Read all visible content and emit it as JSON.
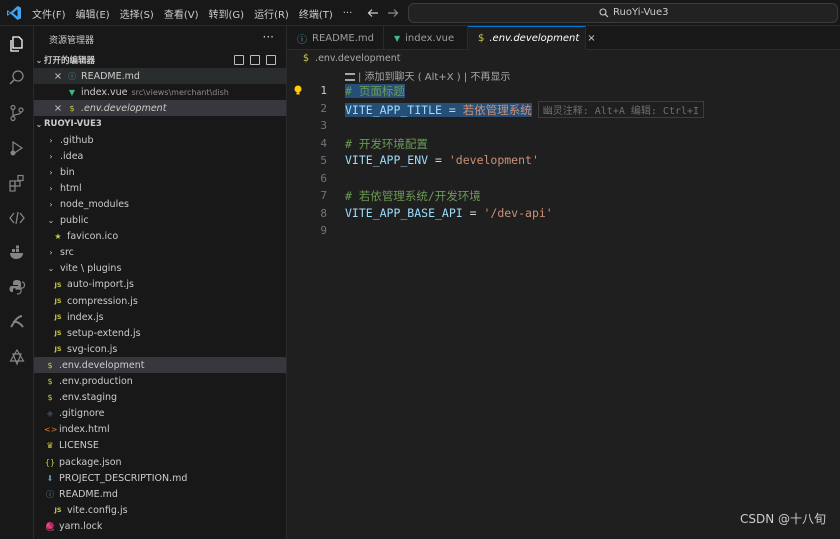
{
  "menu": [
    "文件(F)",
    "编辑(E)",
    "选择(S)",
    "查看(V)",
    "转到(G)",
    "运行(R)",
    "终端(T)",
    "···"
  ],
  "command_center": {
    "label": "RuoYi-Vue3"
  },
  "sidebar": {
    "title": "资源管理器",
    "more": "···",
    "open_editors_title": "打开的编辑器",
    "open_editors": [
      {
        "label": "README.md",
        "icon": "info-icon"
      },
      {
        "label": "index.vue",
        "path": "src\\views\\merchant\\dish",
        "icon": "vue-icon"
      },
      {
        "label": ".env.development",
        "icon": "dollar-icon"
      }
    ],
    "project_title": "RUOYI-VUE3",
    "tree": [
      {
        "label": ".github",
        "type": "folder"
      },
      {
        "label": ".idea",
        "type": "folder"
      },
      {
        "label": "bin",
        "type": "folder"
      },
      {
        "label": "html",
        "type": "folder"
      },
      {
        "label": "node_modules",
        "type": "folder"
      },
      {
        "label": "public",
        "type": "folder-open"
      },
      {
        "label": "favicon.ico",
        "type": "star"
      },
      {
        "label": "src",
        "type": "folder"
      },
      {
        "label": "vite \\ plugins",
        "type": "folder-open"
      },
      {
        "label": "auto-import.js",
        "type": "js"
      },
      {
        "label": "compression.js",
        "type": "js"
      },
      {
        "label": "index.js",
        "type": "js"
      },
      {
        "label": "setup-extend.js",
        "type": "js"
      },
      {
        "label": "svg-icon.js",
        "type": "js"
      },
      {
        "label": ".env.development",
        "type": "dollar"
      },
      {
        "label": ".env.production",
        "type": "dollar"
      },
      {
        "label": ".env.staging",
        "type": "dollar"
      },
      {
        "label": ".gitignore",
        "type": "git"
      },
      {
        "label": "index.html",
        "type": "html"
      },
      {
        "label": "LICENSE",
        "type": "license"
      },
      {
        "label": "package.json",
        "type": "json"
      },
      {
        "label": "PROJECT_DESCRIPTION.md",
        "type": "md"
      },
      {
        "label": "README.md",
        "type": "info"
      },
      {
        "label": "vite.config.js",
        "type": "js"
      },
      {
        "label": "yarn.lock",
        "type": "yarn"
      }
    ]
  },
  "tabs": [
    {
      "label": "README.md",
      "icon": "ⓘ"
    },
    {
      "label": "index.vue",
      "icon": "▼"
    },
    {
      "label": ".env.development",
      "icon": "$",
      "close": "×"
    }
  ],
  "breadcrumb": ".env.development",
  "editor": {
    "hint": "| 添加到聊天 ( Alt+X ) | 不再显示",
    "lines": [
      "1",
      "2",
      "3",
      "4",
      "5",
      "6",
      "7",
      "8",
      "9"
    ],
    "code": {
      "l1": "# 页面标题",
      "l2_key": "VITE_APP_TITLE",
      "l2_op": " = ",
      "l2_val": "若依管理系统",
      "l2_ghost": "幽灵注释: Alt+A 编辑: Ctrl+I",
      "l4": "# 开发环境配置",
      "l5_key": "VITE_APP_ENV",
      "l5_op": " = ",
      "l5_val": "'development'",
      "l7": "# 若依管理系统/开发环境",
      "l8_key": "VITE_APP_BASE_API",
      "l8_op": " = ",
      "l8_val": "'/dev-api'"
    }
  },
  "watermark": "CSDN @十八旬",
  "colors": {
    "accent": "#0078d4",
    "selection": "#264f78",
    "comment": "#6a9955",
    "string": "#ce9178",
    "key": "#9cdcfe"
  }
}
